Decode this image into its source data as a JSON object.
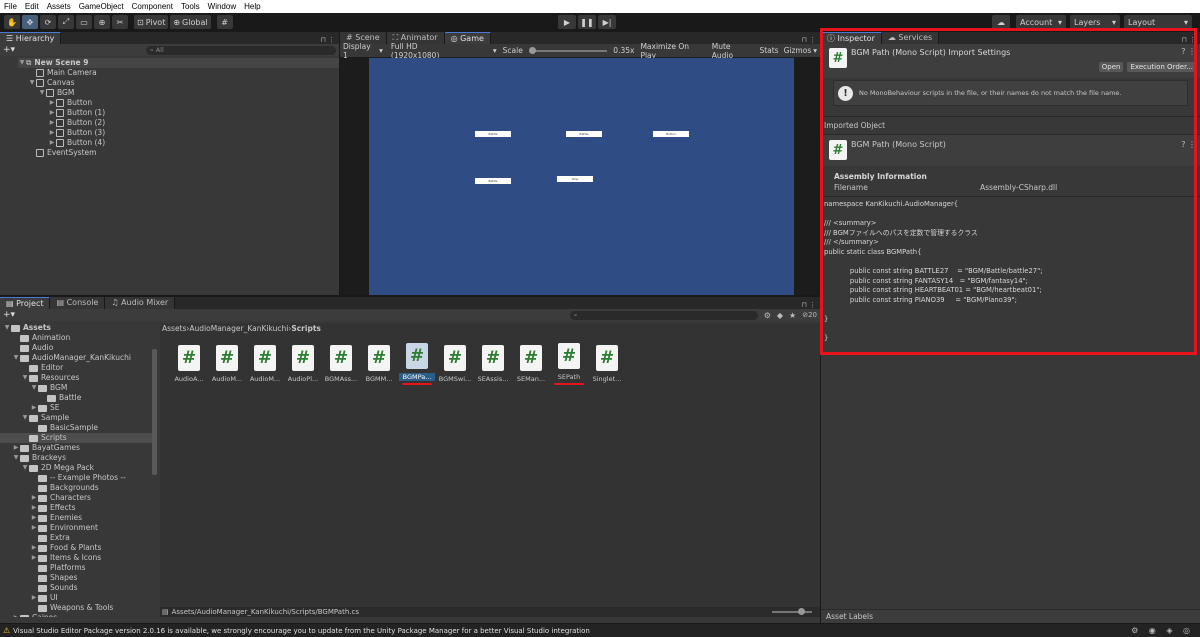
{
  "menu": [
    "File",
    "Edit",
    "Assets",
    "GameObject",
    "Component",
    "Tools",
    "Window",
    "Help"
  ],
  "toolbar": {
    "pivot": "Pivot",
    "global": "Global",
    "account": "Account",
    "layers": "Layers",
    "layout": "Layout"
  },
  "hierarchy": {
    "tab": "Hierarchy",
    "search_placeholder": "All",
    "items": [
      {
        "label": "New Scene 9",
        "indent": 0,
        "arrow": "▼",
        "icon": "scene"
      },
      {
        "label": "Main Camera",
        "indent": 1,
        "arrow": "",
        "icon": "cube"
      },
      {
        "label": "Canvas",
        "indent": 1,
        "arrow": "▼",
        "icon": "cube"
      },
      {
        "label": "BGM",
        "indent": 2,
        "arrow": "▼",
        "icon": "cube"
      },
      {
        "label": "Button",
        "indent": 3,
        "arrow": "▶",
        "icon": "cube"
      },
      {
        "label": "Button (1)",
        "indent": 3,
        "arrow": "▶",
        "icon": "cube"
      },
      {
        "label": "Button (2)",
        "indent": 3,
        "arrow": "▶",
        "icon": "cube"
      },
      {
        "label": "Button (3)",
        "indent": 3,
        "arrow": "▶",
        "icon": "cube"
      },
      {
        "label": "Button (4)",
        "indent": 3,
        "arrow": "▶",
        "icon": "cube"
      },
      {
        "label": "EventSystem",
        "indent": 1,
        "arrow": "",
        "icon": "cube"
      }
    ]
  },
  "game": {
    "tabs": [
      "Scene",
      "Animator",
      "Game"
    ],
    "display": "Display 1",
    "resolution": "Full HD (1920x1080)",
    "scale_label": "Scale",
    "scale_value": "0.35x",
    "maximize": "Maximize On Play",
    "mute": "Mute Audio",
    "stats": "Stats",
    "gizmos": "Gizmos",
    "viewport_color": "#2f4d84"
  },
  "inspector": {
    "tabs": [
      "Inspector",
      "Services"
    ],
    "title": "BGM Path (Mono Script) Import Settings",
    "open_button": "Open",
    "exec_order_button": "Execution Order...",
    "warning": "No MonoBehaviour scripts in the file, or their names do not match the file name.",
    "imported_object_label": "Imported Object",
    "object_name": "BGM Path (Mono Script)",
    "assembly_header": "Assembly Information",
    "filename_label": "Filename",
    "filename_value": "Assembly-CSharp.dll",
    "code_lines": [
      "namespace KanKikuchi.AudioManager{",
      "",
      "/// <summary>",
      "/// BGMファイルへのパスを定数で管理するクラス",
      "/// </summary>",
      "public static class BGMPath{",
      "",
      "            public const string BATTLE27    = \"BGM/Battle/battle27\";",
      "            public const string FANTASY14   = \"BGM/fantasy14\";",
      "            public const string HEARTBEAT01 = \"BGM/heartbeat01\";",
      "            public const string PIANO39     = \"BGM/Piano39\";",
      "",
      "}",
      "",
      "}"
    ],
    "asset_labels": "Asset Labels",
    "highlight_color": "#e8141c"
  },
  "project": {
    "tabs": [
      "Project",
      "Console",
      "Audio Mixer"
    ],
    "breadcrumb": [
      "Assets",
      "AudioManager_KanKikuchi",
      "Scripts"
    ],
    "count": "20",
    "tree": [
      {
        "label": "Assets",
        "indent": 0,
        "arrow": "▼",
        "bold": true
      },
      {
        "label": "Animation",
        "indent": 1,
        "arrow": ""
      },
      {
        "label": "Audio",
        "indent": 1,
        "arrow": ""
      },
      {
        "label": "AudioManager_KanKikuchi",
        "indent": 1,
        "arrow": "▼"
      },
      {
        "label": "Editor",
        "indent": 2,
        "arrow": ""
      },
      {
        "label": "Resources",
        "indent": 2,
        "arrow": "▼"
      },
      {
        "label": "BGM",
        "indent": 3,
        "arrow": "▼"
      },
      {
        "label": "Battle",
        "indent": 4,
        "arrow": ""
      },
      {
        "label": "SE",
        "indent": 3,
        "arrow": "▶"
      },
      {
        "label": "Sample",
        "indent": 2,
        "arrow": "▼"
      },
      {
        "label": "BasicSample",
        "indent": 3,
        "arrow": ""
      },
      {
        "label": "Scripts",
        "indent": 2,
        "arrow": "",
        "sel": true
      },
      {
        "label": "BayatGames",
        "indent": 1,
        "arrow": "▶"
      },
      {
        "label": "Brackeys",
        "indent": 1,
        "arrow": "▼"
      },
      {
        "label": "2D Mega Pack",
        "indent": 2,
        "arrow": "▼"
      },
      {
        "label": "-- Example Photos --",
        "indent": 3,
        "arrow": ""
      },
      {
        "label": "Backgrounds",
        "indent": 3,
        "arrow": ""
      },
      {
        "label": "Characters",
        "indent": 3,
        "arrow": "▶"
      },
      {
        "label": "Effects",
        "indent": 3,
        "arrow": "▶"
      },
      {
        "label": "Enemies",
        "indent": 3,
        "arrow": "▶"
      },
      {
        "label": "Environment",
        "indent": 3,
        "arrow": "▶"
      },
      {
        "label": "Extra",
        "indent": 3,
        "arrow": ""
      },
      {
        "label": "Food & Plants",
        "indent": 3,
        "arrow": "▶"
      },
      {
        "label": "Items & Icons",
        "indent": 3,
        "arrow": "▶"
      },
      {
        "label": "Platforms",
        "indent": 3,
        "arrow": ""
      },
      {
        "label": "Shapes",
        "indent": 3,
        "arrow": ""
      },
      {
        "label": "Sounds",
        "indent": 3,
        "arrow": ""
      },
      {
        "label": "UI",
        "indent": 3,
        "arrow": "▶"
      },
      {
        "label": "Weapons & Tools",
        "indent": 3,
        "arrow": ""
      },
      {
        "label": "Cainos",
        "indent": 1,
        "arrow": "▶"
      }
    ],
    "assets": [
      {
        "label": "AudioA...",
        "sel": false,
        "underline": false
      },
      {
        "label": "AudioM...",
        "sel": false,
        "underline": false
      },
      {
        "label": "AudioM...",
        "sel": false,
        "underline": false
      },
      {
        "label": "AudioPl...",
        "sel": false,
        "underline": false
      },
      {
        "label": "BGMAss...",
        "sel": false,
        "underline": false
      },
      {
        "label": "BGMM...",
        "sel": false,
        "underline": false
      },
      {
        "label": "BGMPa...",
        "sel": true,
        "underline": true
      },
      {
        "label": "BGMSwi...",
        "sel": false,
        "underline": false
      },
      {
        "label": "SEAssis...",
        "sel": false,
        "underline": false
      },
      {
        "label": "SEMan...",
        "sel": false,
        "underline": false
      },
      {
        "label": "SEPath",
        "sel": false,
        "underline": true
      },
      {
        "label": "Singlet...",
        "sel": false,
        "underline": false
      }
    ],
    "status_path": "Assets/AudioManager_KanKikuchi/Scripts/BGMPath.cs"
  },
  "status_bar": {
    "message": "Visual Studio Editor Package version 2.0.16 is available, we strongly encourage you to update from the Unity Package Manager for a better Visual Studio integration",
    "warning_color": "#f0c030"
  }
}
